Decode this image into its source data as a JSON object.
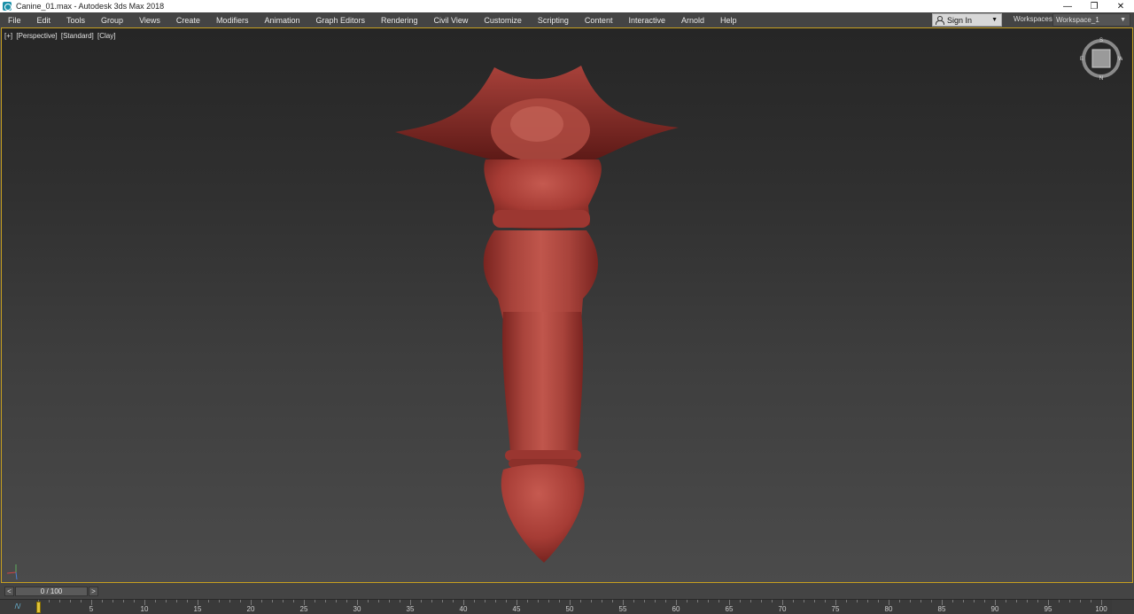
{
  "window": {
    "title": "Canine_01.max - Autodesk 3ds Max 2018",
    "controls": {
      "minimize": "—",
      "restore": "❐",
      "close": "✕"
    }
  },
  "menubar": {
    "items": [
      "File",
      "Edit",
      "Tools",
      "Group",
      "Views",
      "Create",
      "Modifiers",
      "Animation",
      "Graph Editors",
      "Rendering",
      "Civil View",
      "Customize",
      "Scripting",
      "Content",
      "Interactive",
      "Arnold",
      "Help"
    ],
    "sign_in": "Sign In",
    "workspaces_label": "Workspaces:",
    "workspace_value": "Workspace_1"
  },
  "viewport": {
    "label_plus": "[+]",
    "label_view": "[Perspective]",
    "label_shading": "[Standard]",
    "label_style": "[Clay]",
    "viewcube_letters": {
      "n": "S",
      "s": "N",
      "e": "W",
      "w": "E"
    },
    "model_color": "#a93e37",
    "border_color": "#c8a020"
  },
  "timeline": {
    "prev": "<",
    "next": ">",
    "frame_readout": "0 / 100",
    "ticks": [
      "0",
      "5",
      "10",
      "15",
      "20",
      "25",
      "30",
      "35",
      "40",
      "45",
      "50",
      "55",
      "60",
      "65",
      "70",
      "75",
      "80",
      "85",
      "90",
      "95",
      "100"
    ],
    "current_frame": 0
  }
}
